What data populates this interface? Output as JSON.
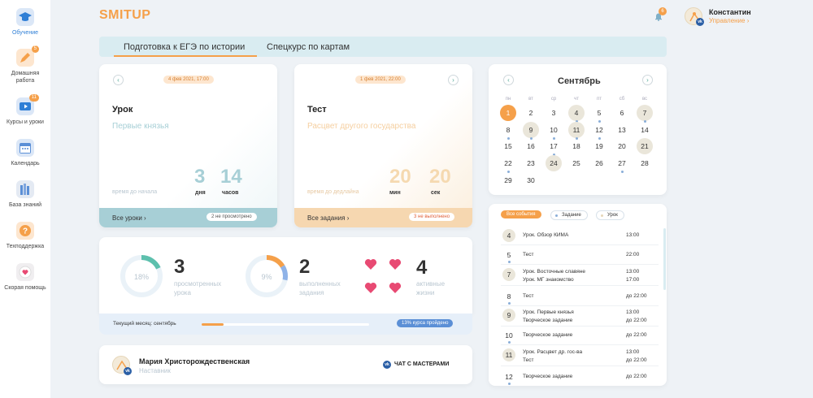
{
  "brand": {
    "logo_text": "SMITUP",
    "accent": "#f5a04a",
    "blue": "#2f7fd6"
  },
  "sidebar": {
    "items": [
      {
        "label": "Обучение",
        "icon": "graduation-cap-icon",
        "active": true
      },
      {
        "label": "Домашняя работа",
        "icon": "pencil-icon",
        "badge": "5"
      },
      {
        "label": "Курсы и уроки",
        "icon": "video-icon",
        "badge": "11"
      },
      {
        "label": "Календарь",
        "icon": "calendar-icon"
      },
      {
        "label": "База знаний",
        "icon": "books-icon"
      },
      {
        "label": "Техподдержка",
        "icon": "question-icon"
      },
      {
        "label": "Скорая помощь",
        "icon": "heart-icon"
      }
    ]
  },
  "header": {
    "notifications": "6",
    "user_name": "Константин",
    "user_role": "Управление"
  },
  "tabs": [
    {
      "label": "Подготовка к ЕГЭ по истории",
      "active": true
    },
    {
      "label": "Спецкурс по картам",
      "active": false
    }
  ],
  "lesson_card": {
    "date": "4 фев 2021, 17:00",
    "type": "Урок",
    "title": "Первые князья",
    "hint": "время до начала",
    "n1": "3",
    "u1": "дня",
    "n2": "14",
    "u2": "часов",
    "footer_link": "Все уроки",
    "footer_badge": "2 не просмотрено"
  },
  "test_card": {
    "date": "1 фев 2021, 22:00",
    "type": "Тест",
    "title": "Расцвет другого государства",
    "hint": "время до дедлайна",
    "n1": "20",
    "u1": "мин",
    "n2": "20",
    "u2": "сек",
    "footer_link": "Все задания",
    "footer_badge": "3 не выполнено"
  },
  "calendar": {
    "month": "Сентябрь",
    "weekdays": [
      "пн",
      "вт",
      "ср",
      "чт",
      "пт",
      "сб",
      "вс"
    ],
    "days": [
      [
        "1",
        "2",
        "3",
        "4",
        "5",
        "6",
        "7"
      ],
      [
        "8",
        "9",
        "10",
        "11",
        "12",
        "13",
        "14"
      ],
      [
        "15",
        "16",
        "17",
        "18",
        "19",
        "20",
        "21"
      ],
      [
        "22",
        "23",
        "24",
        "25",
        "26",
        "27",
        "28"
      ],
      [
        "29",
        "30",
        "",
        "",
        "",
        "",
        ""
      ]
    ]
  },
  "events": {
    "filters": [
      "Все события",
      "Задание",
      "Урок"
    ],
    "rows": [
      {
        "day": "4",
        "lines": [
          "Урок. Обзор КИМА"
        ],
        "times": [
          "13:00"
        ],
        "hl": true
      },
      {
        "day": "5",
        "lines": [
          "Тест"
        ],
        "times": [
          "22:00"
        ],
        "dot": true
      },
      {
        "day": "7",
        "lines": [
          "Урок. Восточные славяне",
          "Урок. МГ знакомство"
        ],
        "times": [
          "13:00",
          "17:00"
        ],
        "hl": true
      },
      {
        "day": "8",
        "lines": [
          "Тест"
        ],
        "times": [
          "до 22:00"
        ],
        "dot": true
      },
      {
        "day": "9",
        "lines": [
          "Урок. Первые князья",
          "Творческое задание"
        ],
        "times": [
          "13:00",
          "до 22:00"
        ],
        "hl": true
      },
      {
        "day": "10",
        "lines": [
          "Творческое задание"
        ],
        "times": [
          "до 22:00"
        ],
        "dot": true
      },
      {
        "day": "11",
        "lines": [
          "Урок. Расцвет др. гос-ва",
          "Тест"
        ],
        "times": [
          "13:00",
          "до 22:00"
        ],
        "hl": true
      },
      {
        "day": "12",
        "lines": [
          "Творческое задание"
        ],
        "times": [
          "до 22:00"
        ],
        "dot": true
      }
    ]
  },
  "stats": {
    "viewed": {
      "pct": "18%",
      "fraction": 0.18,
      "num": "3",
      "label1": "просмотренных",
      "label2": "урока"
    },
    "done": {
      "pct": "9%",
      "fraction": 0.09,
      "num": "2",
      "label1": "выполненных",
      "label2": "задания"
    },
    "lives": {
      "num": "4",
      "label1": "активные",
      "label2": "жизни",
      "count": 4
    },
    "month_label": "Текущий месяц: сентябрь",
    "progress_fraction": 0.13,
    "progress_badge": "13% курса пройдено"
  },
  "mentor": {
    "name": "Мария Христорождественская",
    "role": "Наставник",
    "chat": "ЧАТ С МАСТЕРАМИ"
  }
}
